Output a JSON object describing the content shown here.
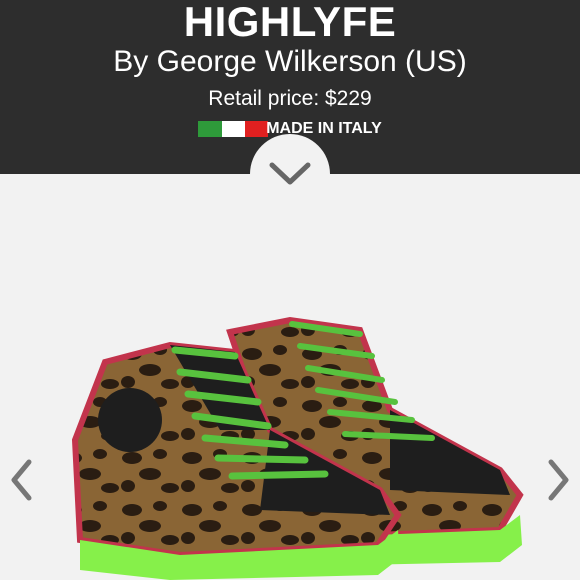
{
  "header": {
    "title": "HIGHLYFE",
    "byline": "By George Wilkerson (US)",
    "price": "Retail price: $229",
    "made_in": "MADE IN ITALY",
    "flag_colors": [
      "#2e9a3a",
      "#ffffff",
      "#e02020"
    ],
    "background": "#2d2d2d"
  },
  "controls": {
    "expand_icon": "chevron-down-icon",
    "prev_icon": "chevron-left-icon",
    "next_icon": "chevron-right-icon"
  },
  "product_image": {
    "subject": "leopard-print high-top sneakers",
    "colors": {
      "print_base": "#8a6535",
      "print_spots": "#2a1d12",
      "laces": "#58c23e",
      "trim": "#c2344c",
      "sole": "#86f04a",
      "leather": "#1e1e1e"
    }
  }
}
